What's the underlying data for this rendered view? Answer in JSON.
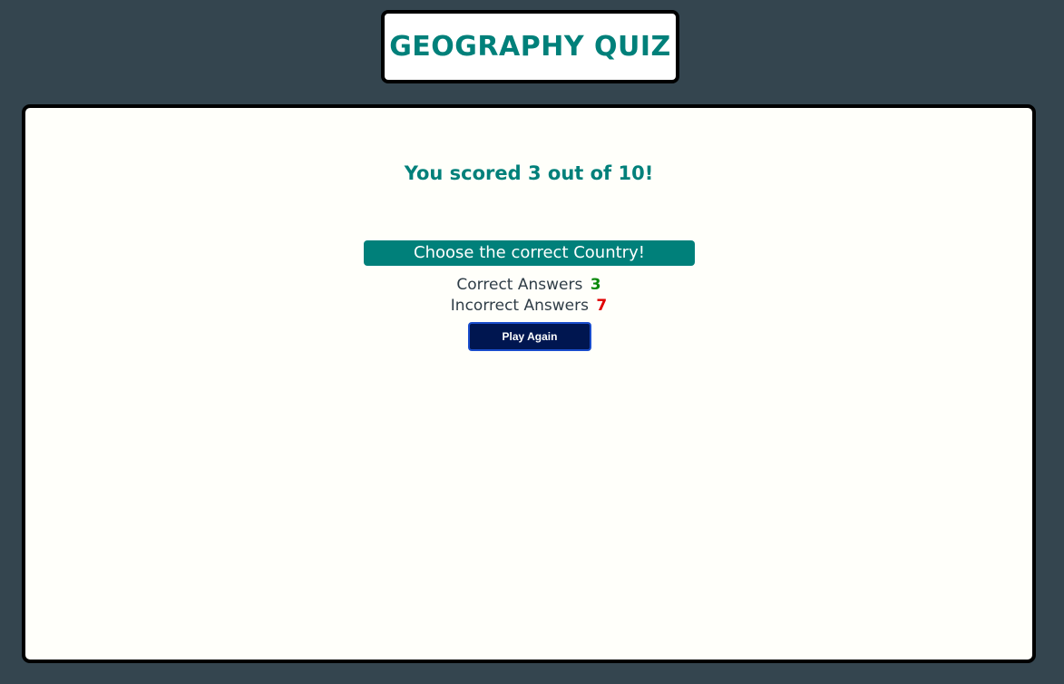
{
  "header": {
    "title": "GEOGRAPHY QUIZ"
  },
  "result": {
    "score_text": "You scored 3 out of 10!",
    "prompt": "Choose the correct Country!",
    "correct_label": "Correct Answers",
    "correct_count": "3",
    "incorrect_label": "Incorrect Answers",
    "incorrect_count": "7",
    "play_again_label": "Play Again"
  },
  "colors": {
    "background": "#34454f",
    "accent_teal": "#00807a",
    "correct_green": "#0d8a0d",
    "incorrect_red": "#e00000",
    "button_navy": "#001650"
  }
}
